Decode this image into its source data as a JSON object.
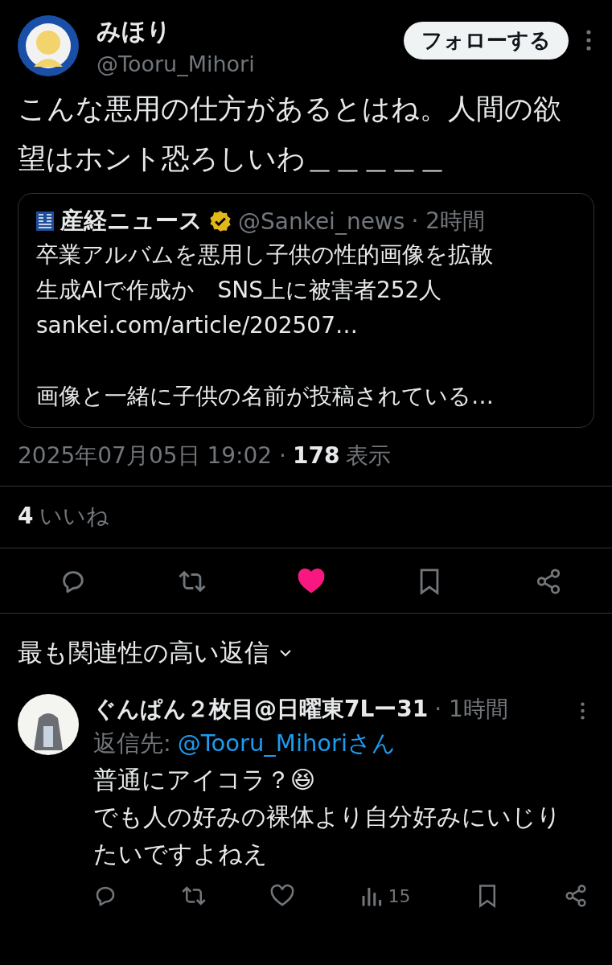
{
  "post": {
    "author_name": "みほり",
    "handle": "@Tooru_Mihori",
    "follow_label": "フォローする",
    "text": "こんな悪用の仕方があるとはね。人間の欲望はホント恐ろしいわ＿＿＿＿＿",
    "quote": {
      "source_name": "産経ニュース",
      "verified": true,
      "handle": "@Sankei_news",
      "time": "· 2時間",
      "paragraphs": [
        [
          "卒業アルバムを悪用し子供の性的画像を拡散",
          "生成AIで作成か　SNS上に被害者252人",
          "sankei.com/article/202507…"
        ],
        [
          "画像と一緒に子供の名前が投稿されている…"
        ]
      ]
    },
    "timestamp": "2025年07月05日 19:02 ·",
    "views_count": "178",
    "views_label": "表示",
    "likes_count": "4",
    "likes_label": "いいね",
    "actions": [
      {
        "kind": "reply"
      },
      {
        "kind": "repost"
      },
      {
        "kind": "like",
        "liked": true
      },
      {
        "kind": "bookmark"
      },
      {
        "kind": "share"
      }
    ]
  },
  "replies_sort": "最も関連性の高い返信",
  "reply": {
    "author_name": "ぐんぱん２枚目@日曜東7Lー31",
    "time": "· 1時間",
    "reply_to_label": "返信先:",
    "reply_to_handle": "@Tooru_Mihoriさん",
    "text": "普通にアイコラ？😆\nでも人の好みの裸体より自分好みにいじりたいですよねえ",
    "actions": [
      {
        "kind": "reply"
      },
      {
        "kind": "repost"
      },
      {
        "kind": "like",
        "liked": false
      },
      {
        "kind": "views",
        "count": "15"
      },
      {
        "kind": "bookmark"
      },
      {
        "kind": "share"
      }
    ]
  }
}
